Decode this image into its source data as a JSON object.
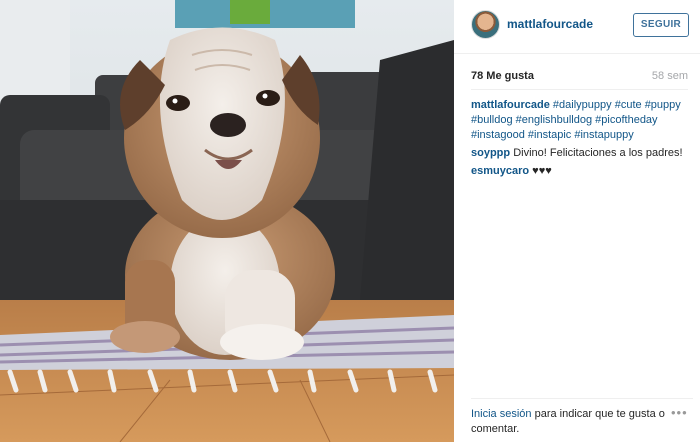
{
  "header": {
    "username": "mattlafourcade",
    "follow_label": "SEGUIR"
  },
  "stats": {
    "likes": "78 Me gusta",
    "time_ago": "58 sem"
  },
  "caption": {
    "author": "mattlafourcade",
    "tags": [
      "#dailypuppy",
      "#cute",
      "#puppy",
      "#bulldog",
      "#englishbulldog",
      "#picoftheday",
      "#instagood",
      "#instapic",
      "#instapuppy"
    ]
  },
  "comments": [
    {
      "author": "soyppp",
      "text": "Divino! Felicitaciones a los padres!"
    },
    {
      "author": "esmuycaro",
      "text": "♥♥♥"
    }
  ],
  "footer": {
    "login_link": "Inicia sesión",
    "login_suffix": "para indicar que te gusta o comentar."
  },
  "icons": {
    "more": "more-options-icon"
  },
  "colors": {
    "link": "#125688",
    "follow_border": "#3f729b",
    "muted": "#a5a7aa"
  }
}
